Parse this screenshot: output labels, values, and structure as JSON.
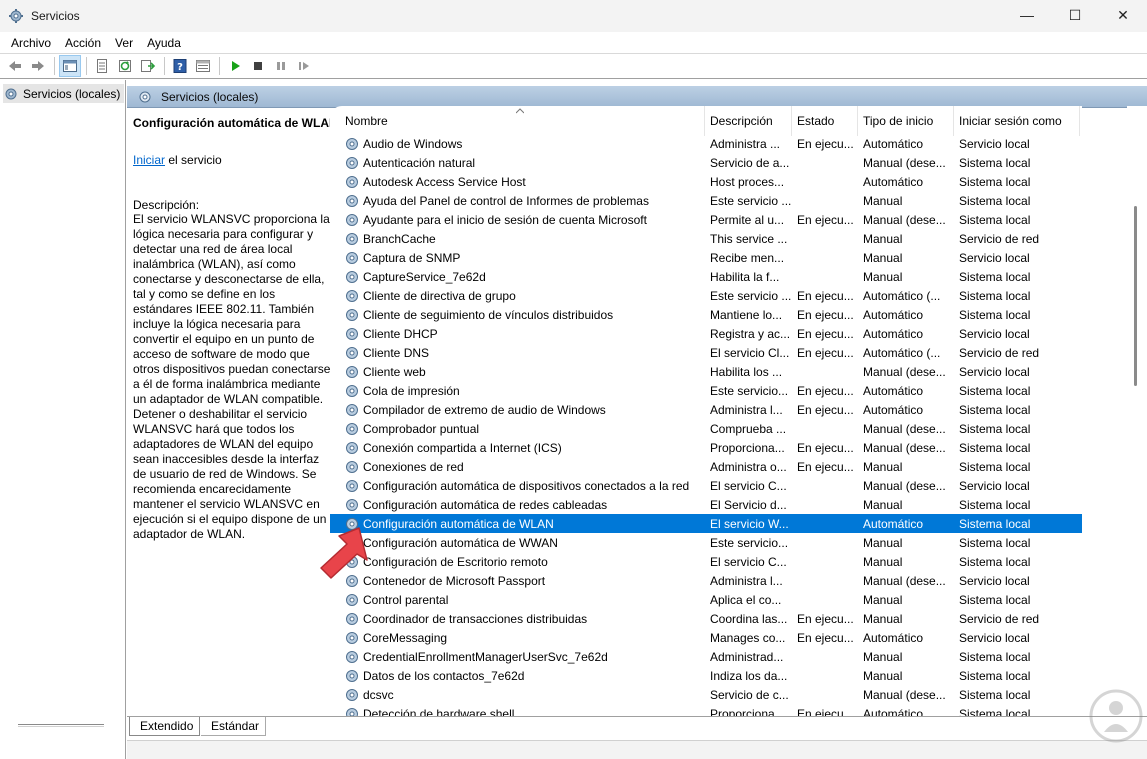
{
  "window": {
    "title": "Servicios",
    "minimize": "—",
    "maximize": "☐",
    "close": "✕"
  },
  "menu": [
    "Archivo",
    "Acción",
    "Ver",
    "Ayuda"
  ],
  "tree": {
    "root": "Servicios (locales)"
  },
  "content_header": "Servicios (locales)",
  "details": {
    "title": "Configuración automática de WLAN",
    "action_link": "Iniciar",
    "action_suffix": " el servicio",
    "desc_label": "Descripción:",
    "desc_text": "El servicio WLANSVC proporciona la lógica necesaria para configurar y detectar una red de área local inalámbrica (WLAN), así como conectarse y desconectarse de ella, tal y como se define en los estándares IEEE 802.11. También incluye la lógica necesaria para convertir el equipo en un punto de acceso de software de modo que otros dispositivos puedan conectarse a él de forma inalámbrica mediante un adaptador de WLAN compatible. Detener o deshabilitar el servicio WLANSVC hará que todos los adaptadores de WLAN del equipo sean inaccesibles desde la interfaz de usuario de red de Windows. Se recomienda encarecidamente mantener el servicio WLANSVC en ejecución si el equipo dispone de un adaptador de WLAN."
  },
  "columns": [
    "Nombre",
    "Descripción",
    "Estado",
    "Tipo de inicio",
    "Iniciar sesión como"
  ],
  "rows": [
    [
      "Audio de Windows",
      "Administra ...",
      "En ejecu...",
      "Automático",
      "Servicio local"
    ],
    [
      "Autenticación natural",
      "Servicio de a...",
      "",
      "Manual (dese...",
      "Sistema local"
    ],
    [
      "Autodesk Access Service Host",
      "Host proces...",
      "",
      "Automático",
      "Sistema local"
    ],
    [
      "Ayuda del Panel de control de Informes de problemas",
      "Este servicio ...",
      "",
      "Manual",
      "Sistema local"
    ],
    [
      "Ayudante para el inicio de sesión de cuenta Microsoft",
      "Permite al u...",
      "En ejecu...",
      "Manual (dese...",
      "Sistema local"
    ],
    [
      "BranchCache",
      "This service ...",
      "",
      "Manual",
      "Servicio de red"
    ],
    [
      "Captura de SNMP",
      "Recibe men...",
      "",
      "Manual",
      "Servicio local"
    ],
    [
      "CaptureService_7e62d",
      "Habilita la f...",
      "",
      "Manual",
      "Sistema local"
    ],
    [
      "Cliente de directiva de grupo",
      "Este servicio ...",
      "En ejecu...",
      "Automático (...",
      "Sistema local"
    ],
    [
      "Cliente de seguimiento de vínculos distribuidos",
      "Mantiene lo...",
      "En ejecu...",
      "Automático",
      "Sistema local"
    ],
    [
      "Cliente DHCP",
      "Registra y ac...",
      "En ejecu...",
      "Automático",
      "Servicio local"
    ],
    [
      "Cliente DNS",
      "El servicio Cl...",
      "En ejecu...",
      "Automático (...",
      "Servicio de red"
    ],
    [
      "Cliente web",
      "Habilita los ...",
      "",
      "Manual (dese...",
      "Servicio local"
    ],
    [
      "Cola de impresión",
      "Este servicio...",
      "En ejecu...",
      "Automático",
      "Sistema local"
    ],
    [
      "Compilador de extremo de audio de Windows",
      "Administra l...",
      "En ejecu...",
      "Automático",
      "Sistema local"
    ],
    [
      "Comprobador puntual",
      "Comprueba ...",
      "",
      "Manual (dese...",
      "Sistema local"
    ],
    [
      "Conexión compartida a Internet (ICS)",
      "Proporciona...",
      "En ejecu...",
      "Manual (dese...",
      "Sistema local"
    ],
    [
      "Conexiones de red",
      "Administra o...",
      "En ejecu...",
      "Manual",
      "Sistema local"
    ],
    [
      "Configuración automática de dispositivos conectados a la red",
      "El servicio C...",
      "",
      "Manual (dese...",
      "Servicio local"
    ],
    [
      "Configuración automática de redes cableadas",
      "El Servicio d...",
      "",
      "Manual",
      "Sistema local"
    ],
    [
      "Configuración automática de WLAN",
      "El servicio W...",
      "",
      "Automático",
      "Sistema local"
    ],
    [
      "Configuración automática de WWAN",
      "Este servicio...",
      "",
      "Manual",
      "Sistema local"
    ],
    [
      "Configuración de Escritorio remoto",
      "El servicio C...",
      "",
      "Manual",
      "Sistema local"
    ],
    [
      "Contenedor de Microsoft Passport",
      "Administra l...",
      "",
      "Manual (dese...",
      "Servicio local"
    ],
    [
      "Control parental",
      "Aplica el co...",
      "",
      "Manual",
      "Sistema local"
    ],
    [
      "Coordinador de transacciones distribuidas",
      "Coordina las...",
      "En ejecu...",
      "Manual",
      "Servicio de red"
    ],
    [
      "CoreMessaging",
      "Manages co...",
      "En ejecu...",
      "Automático",
      "Servicio local"
    ],
    [
      "CredentialEnrollmentManagerUserSvc_7e62d",
      "Administrad...",
      "",
      "Manual",
      "Sistema local"
    ],
    [
      "Datos de los contactos_7e62d",
      "Indiza los da...",
      "",
      "Manual",
      "Sistema local"
    ],
    [
      "dcsvc",
      "Servicio de c...",
      "",
      "Manual (dese...",
      "Sistema local"
    ],
    [
      "Detección de hardware shell",
      "Proporciona...",
      "En ejecu...",
      "Automático",
      "Sistema local"
    ]
  ],
  "selected_index": 20,
  "tabs": [
    "Extendido",
    "Estándar"
  ],
  "colors": {
    "selection": "#0078d7",
    "arrow": "#e8444a",
    "header_gradient": "#bcd0e4"
  }
}
